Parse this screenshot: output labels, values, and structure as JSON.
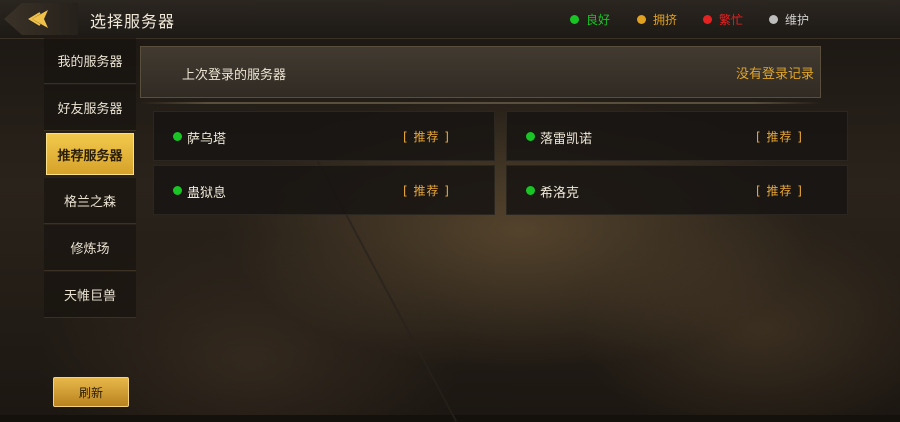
{
  "header": {
    "title": "选择服务器",
    "legend": [
      {
        "label": "良好",
        "color": "#18c524"
      },
      {
        "label": "拥挤",
        "color": "#e0a020"
      },
      {
        "label": "繁忙",
        "color": "#e52222"
      },
      {
        "label": "维护",
        "color": "#bdbdbd"
      }
    ]
  },
  "sidebar": {
    "items": [
      {
        "label": "我的服务器"
      },
      {
        "label": "好友服务器"
      },
      {
        "label": "推荐服务器"
      },
      {
        "label": "格兰之森"
      },
      {
        "label": "修炼场"
      },
      {
        "label": "天帷巨兽"
      }
    ],
    "refresh_label": "刷新"
  },
  "last_login": {
    "label": "上次登录的服务器",
    "value": "没有登录记录"
  },
  "servers": [
    {
      "name": "萨乌塔",
      "tag": "[ 推荐 ]",
      "status_color": "#18c524"
    },
    {
      "name": "落雷凯诺",
      "tag": "[ 推荐 ]",
      "status_color": "#18c524"
    },
    {
      "name": "蛊狱息",
      "tag": "[ 推荐 ]",
      "status_color": "#18c524"
    },
    {
      "name": "希洛克",
      "tag": "[ 推荐 ]",
      "status_color": "#18c524"
    }
  ],
  "colors": {
    "accent_gold": "#e0a52a",
    "active_tab": "#f2c94c",
    "text": "#efe8d8"
  },
  "icons": {
    "back": "back-arrow-icon"
  }
}
